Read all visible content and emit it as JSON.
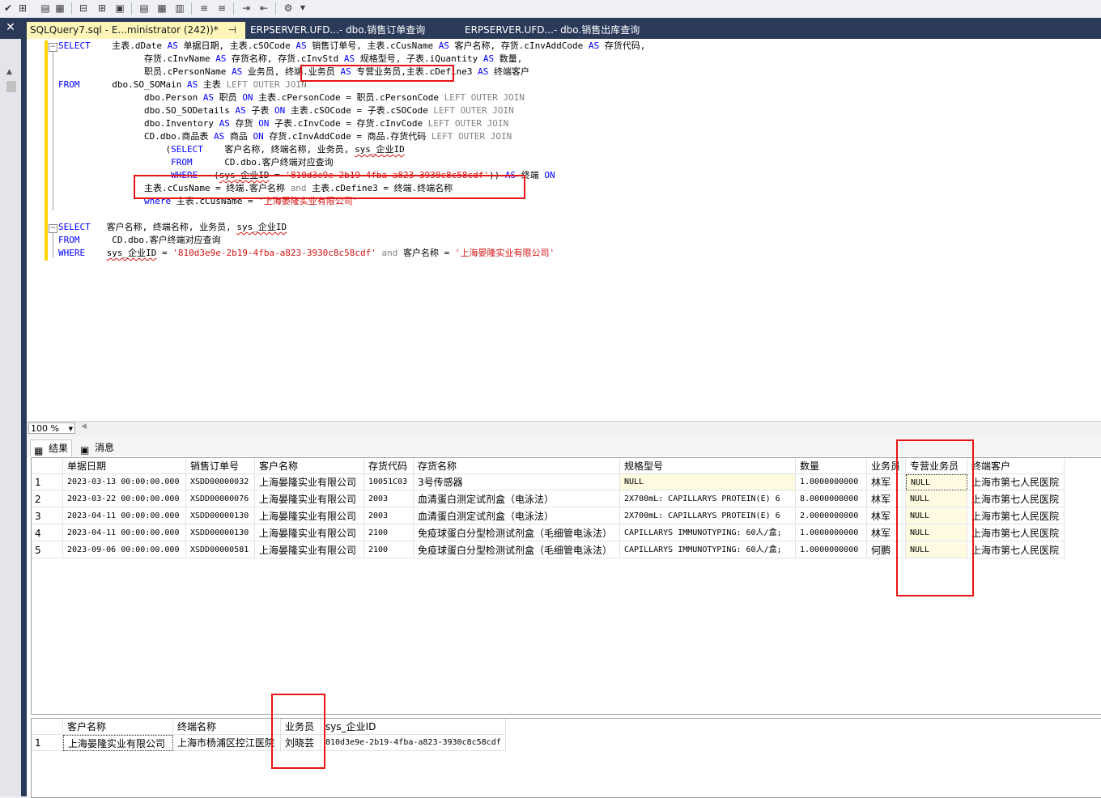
{
  "toolbar": {
    "icons": [
      "checkmark-icon",
      "tree-icon",
      "view-icon",
      "grid-icon",
      "relationship-icon",
      "query-design-icon",
      "parse-icon",
      "include-plan-icon",
      "text-results-icon",
      "grid-results-icon",
      "file-results-icon",
      "comment-icon",
      "uncomment-icon",
      "indent-icon",
      "outdent-icon",
      "specify-values-icon"
    ]
  },
  "tabs": [
    {
      "label": "SQLQuery7.sql - E...ministrator (242))*",
      "pin": "⊣",
      "close": "×",
      "active": true
    },
    {
      "label": "ERPSERVER.UFD...- dbo.销售订单查询",
      "active": false
    },
    {
      "label": "ERPSERVER.UFD...- dbo.销售出库查询",
      "active": false
    }
  ],
  "editor": {
    "lines": [
      "SELECT    主表.dDate AS 单据日期, 主表.cSOCode AS 销售订单号, 主表.cCusName AS 客户名称, 存货.cInvAddCode AS 存货代码,",
      "                存货.cInvName AS 存货名称, 存货.cInvStd AS 规格型号, 子表.iQuantity AS 数量,",
      "                职员.cPersonName AS 业务员, 终端.业务员 AS 专营业务员,主表.cDefine3 AS 终端客户",
      "FROM      dbo.SO_SOMain AS 主表 LEFT OUTER JOIN",
      "                dbo.Person AS 职员 ON 主表.cPersonCode = 职员.cPersonCode LEFT OUTER JOIN",
      "                dbo.SO_SODetails AS 子表 ON 主表.cSOCode = 子表.cSOCode LEFT OUTER JOIN",
      "                dbo.Inventory AS 存货 ON 子表.cInvCode = 存货.cInvCode LEFT OUTER JOIN",
      "                CD.dbo.商品表 AS 商品 ON 存货.cInvAddCode = 商品.存货代码 LEFT OUTER JOIN",
      "                    (SELECT    客户名称, 终端名称, 业务员, sys_企业ID",
      "                     FROM      CD.dbo.客户终端对应查询",
      "                     WHERE   (sys_企业ID = '810d3e9e-2b19-4fba-a823-3930c8c58cdf')) AS 终端 ON",
      "                主表.cCusName = 终端.客户名称 and 主表.cDefine3 = 终端.终端名称",
      "                where 主表.cCusName = '上海晏隆实业有限公司'",
      "",
      "SELECT   客户名称, 终端名称, 业务员, sys_企业ID",
      "FROM      CD.dbo.客户终端对应查询",
      "WHERE    sys_企业ID = '810d3e9e-2b19-4fba-a823-3930c8c58cdf' and 客户名称 = '上海晏隆实业有限公司'"
    ]
  },
  "zoom": {
    "value": "100 %"
  },
  "results_tabs": [
    {
      "label": "结果",
      "icon": "grid-icon",
      "active": true
    },
    {
      "label": "消息",
      "icon": "message-icon",
      "active": false
    }
  ],
  "grid1": {
    "columns": [
      "单据日期",
      "销售订单号",
      "客户名称",
      "存货代码",
      "存货名称",
      "规格型号",
      "数量",
      "业务员",
      "专营业务员",
      "终端客户"
    ],
    "rows": [
      [
        "1",
        "2023-03-13 00:00:00.000",
        "XSDD00000032",
        "上海晏隆实业有限公司",
        "10051C03",
        "3号传感器",
        "NULL",
        "1.0000000000",
        "林军",
        "NULL",
        "上海市第七人民医院"
      ],
      [
        "2",
        "2023-03-22 00:00:00.000",
        "XSDD00000076",
        "上海晏隆实业有限公司",
        "2003",
        "血清蛋白测定试剂盒（电泳法）",
        "2X700mL: CAPILLARYS PROTEIN(E) 6",
        "8.0000000000",
        "林军",
        "NULL",
        "上海市第七人民医院"
      ],
      [
        "3",
        "2023-04-11 00:00:00.000",
        "XSDD00000130",
        "上海晏隆实业有限公司",
        "2003",
        "血清蛋白测定试剂盒（电泳法）",
        "2X700mL: CAPILLARYS PROTEIN(E) 6",
        "2.0000000000",
        "林军",
        "NULL",
        "上海市第七人民医院"
      ],
      [
        "4",
        "2023-04-11 00:00:00.000",
        "XSDD00000130",
        "上海晏隆实业有限公司",
        "2100",
        "免疫球蛋白分型检测试剂盒（毛细管电泳法）",
        "CAPILLARYS IMMUNOTYPING: 60人/盒;",
        "1.0000000000",
        "林军",
        "NULL",
        "上海市第七人民医院"
      ],
      [
        "5",
        "2023-09-06 00:00:00.000",
        "XSDD00000581",
        "上海晏隆实业有限公司",
        "2100",
        "免疫球蛋白分型检测试剂盒（毛细管电泳法）",
        "CAPILLARYS IMMUNOTYPING: 60人/盒;",
        "1.0000000000",
        "何鹏",
        "NULL",
        "上海市第七人民医院"
      ]
    ]
  },
  "grid2": {
    "columns": [
      "客户名称",
      "终端名称",
      "业务员",
      "sys_企业ID"
    ],
    "rows": [
      [
        "1",
        "上海晏隆实业有限公司",
        "上海市杨浦区控江医院",
        "刘晓芸",
        "810d3e9e-2b19-4fba-a823-3930c8c58cdf"
      ]
    ]
  },
  "colors": {
    "tabstrip": "#2b3a59",
    "active_tab": "#fef5b8",
    "keyword": "#0000ff",
    "string": "#d41111",
    "highlight_box": "#e81414"
  }
}
